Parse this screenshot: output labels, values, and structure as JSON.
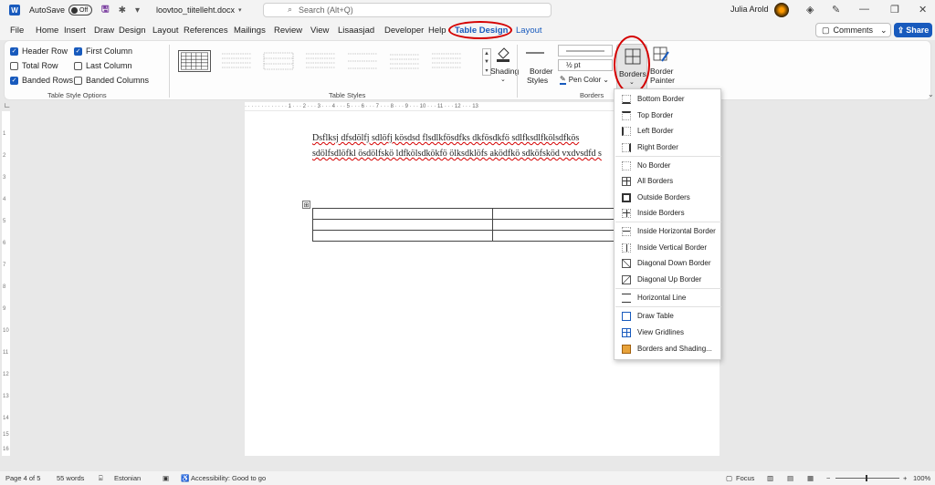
{
  "titlebar": {
    "autosave_label": "AutoSave",
    "autosave_state": "Off",
    "doc_name": "loovtoo_tiitelleht.docx",
    "search_placeholder": "Search (Alt+Q)",
    "user_name": "Julia Arold"
  },
  "menu": {
    "tabs": [
      "File",
      "Home",
      "Insert",
      "Draw",
      "Design",
      "Layout",
      "References",
      "Mailings",
      "Review",
      "View",
      "Lisaasjad",
      "Developer",
      "Help",
      "Table Design",
      "Layout"
    ],
    "comments_label": "Comments",
    "share_label": "Share"
  },
  "ribbon": {
    "style_options": {
      "header_row": "Header Row",
      "first_column": "First Column",
      "total_row": "Total Row",
      "last_column": "Last Column",
      "banded_rows": "Banded Rows",
      "banded_columns": "Banded Columns",
      "group_label": "Table Style Options"
    },
    "table_styles_label": "Table Styles",
    "shading_label": "Shading",
    "border_styles_label1": "Border",
    "border_styles_label2": "Styles",
    "pen_weight": "½ pt",
    "pen_color_label": "Pen Color",
    "borders_label": "Borders",
    "border_painter1": "Border",
    "border_painter2": "Painter",
    "borders_group_label": "Borders"
  },
  "ruler_text": "· · · · · · · · · · · · · 1 · · · 2 · · · 3 · · · 4 · · · 5 · · · 6 · · · 7 · · · 8 · · · 9 · · · 10 · · · 11 · · · 12 · · · 13",
  "vruler_marks": [
    "1",
    "2",
    "3",
    "4",
    "5",
    "6",
    "7",
    "8",
    "9",
    "10",
    "11",
    "12",
    "13",
    "14",
    "15",
    "16"
  ],
  "document": {
    "line1": "Dsflksj dfsdölfj sdlöfj kösdsd flsdlkfösdfks dkfösdkfö sdlfksdlfkölsdfkös",
    "line2": "sdölfsdlöfkl ösdölfskö ldfkölsdkökfö ölksdklöfs aködfkö sdköfsköd vxdvsdfd s"
  },
  "borders_menu": {
    "items": [
      "Bottom Border",
      "Top Border",
      "Left Border",
      "Right Border",
      "No Border",
      "All Borders",
      "Outside Borders",
      "Inside Borders",
      "Inside Horizontal Border",
      "Inside Vertical Border",
      "Diagonal Down Border",
      "Diagonal Up Border",
      "Horizontal Line",
      "Draw Table",
      "View Gridlines",
      "Borders and Shading..."
    ]
  },
  "statusbar": {
    "page": "Page 4 of 5",
    "words": "55 words",
    "language": "Estonian",
    "accessibility": "Accessibility: Good to go",
    "focus": "Focus",
    "zoom": "100%"
  },
  "colors": {
    "accent": "#185abd",
    "annotation_red": "#d40000"
  }
}
